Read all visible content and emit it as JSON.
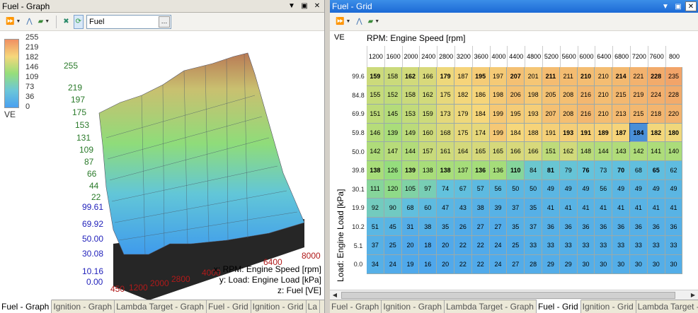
{
  "left": {
    "title": "Fuel - Graph",
    "combo_value": "Fuel",
    "legend": [
      "255",
      "219",
      "182",
      "146",
      "109",
      "73",
      "36",
      "0"
    ],
    "legend_title": "VE",
    "z_ticks": [
      "255",
      "219",
      "197",
      "175",
      "153",
      "131",
      "109",
      "87",
      "66",
      "44",
      "22"
    ],
    "load_ticks": [
      "99.61",
      "69.92",
      "50.00",
      "30.08",
      "10.16",
      "0.00"
    ],
    "x_ticks": [
      "450",
      "1200",
      "2000",
      "2800",
      "4000",
      "6400",
      "8000"
    ],
    "axis_x": "x: RPM: Engine Speed [rpm]",
    "axis_y": "y: Load: Engine Load [kPa]",
    "axis_z": "z: Fuel [VE]",
    "tabs": [
      "Fuel - Graph",
      "Ignition - Graph",
      "Lambda Target - Graph",
      "Fuel - Grid",
      "Ignition - Grid",
      "La"
    ]
  },
  "right": {
    "title": "Fuel - Grid",
    "corner_label": "VE",
    "x_title": "RPM: Engine Speed [rpm]",
    "y_title": "Load: Engine Load [kPa]",
    "rpm": [
      "1200",
      "1600",
      "2000",
      "2400",
      "2800",
      "3200",
      "3600",
      "4000",
      "4400",
      "4800",
      "5200",
      "5600",
      "6000",
      "6400",
      "6800",
      "7200",
      "7600",
      "800"
    ],
    "loads": [
      "99.6",
      "84.8",
      "69.9",
      "59.8",
      "50.0",
      "39.8",
      "30.1",
      "19.9",
      "10.2",
      "5.1",
      "0.0"
    ],
    "rows": [
      [
        "159",
        "158",
        "162",
        "166",
        "179",
        "187",
        "195",
        "197",
        "207",
        "201",
        "211",
        "211",
        "210",
        "210",
        "214",
        "221",
        "228",
        "235"
      ],
      [
        "155",
        "152",
        "158",
        "162",
        "175",
        "182",
        "186",
        "198",
        "206",
        "198",
        "205",
        "208",
        "216",
        "210",
        "215",
        "219",
        "224",
        "228"
      ],
      [
        "151",
        "145",
        "153",
        "159",
        "173",
        "179",
        "184",
        "199",
        "195",
        "193",
        "207",
        "208",
        "216",
        "210",
        "213",
        "215",
        "218",
        "220"
      ],
      [
        "146",
        "139",
        "149",
        "160",
        "168",
        "175",
        "174",
        "199",
        "184",
        "188",
        "191",
        "193",
        "191",
        "189",
        "187",
        "184",
        "182",
        "180"
      ],
      [
        "142",
        "147",
        "144",
        "157",
        "161",
        "164",
        "165",
        "165",
        "166",
        "166",
        "151",
        "162",
        "148",
        "144",
        "143",
        "142",
        "141",
        "140"
      ],
      [
        "138",
        "126",
        "139",
        "138",
        "138",
        "137",
        "136",
        "136",
        "110",
        "84",
        "81",
        "79",
        "76",
        "73",
        "70",
        "68",
        "65",
        "62"
      ],
      [
        "111",
        "120",
        "105",
        "97",
        "74",
        "67",
        "57",
        "56",
        "50",
        "50",
        "49",
        "49",
        "49",
        "56",
        "49",
        "49",
        "49",
        "49"
      ],
      [
        "92",
        "90",
        "68",
        "60",
        "47",
        "43",
        "38",
        "39",
        "37",
        "35",
        "41",
        "41",
        "41",
        "41",
        "41",
        "41",
        "41",
        "41"
      ],
      [
        "51",
        "45",
        "31",
        "38",
        "35",
        "26",
        "27",
        "27",
        "35",
        "37",
        "36",
        "36",
        "36",
        "36",
        "36",
        "36",
        "36",
        "36"
      ],
      [
        "37",
        "25",
        "20",
        "18",
        "20",
        "22",
        "22",
        "24",
        "25",
        "33",
        "33",
        "33",
        "33",
        "33",
        "33",
        "33",
        "33",
        "33"
      ],
      [
        "34",
        "24",
        "19",
        "16",
        "20",
        "22",
        "22",
        "24",
        "27",
        "28",
        "29",
        "29",
        "30",
        "30",
        "30",
        "30",
        "30",
        "30"
      ]
    ],
    "tabs": [
      "Fuel - Graph",
      "Ignition - Graph",
      "Lambda Target - Graph",
      "Fuel - Grid",
      "Ignition - Grid",
      "Lambda Target -"
    ]
  }
}
